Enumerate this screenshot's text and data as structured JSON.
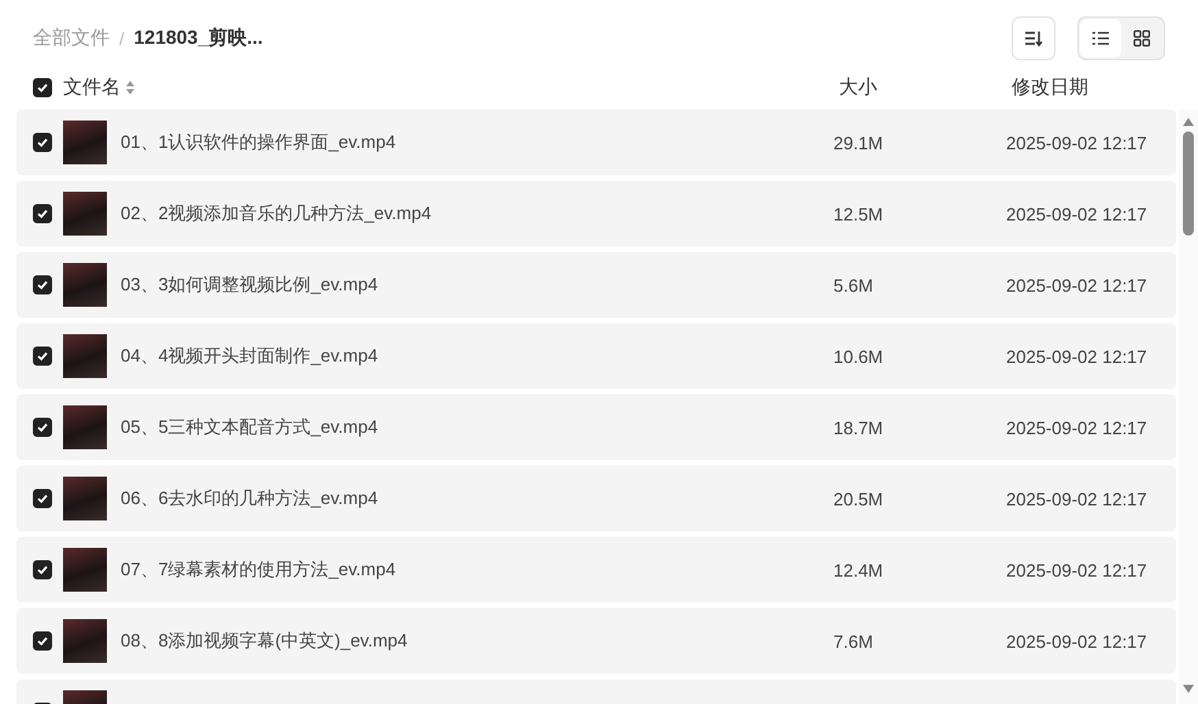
{
  "breadcrumb_separator": "/",
  "breadcrumb": [
    {
      "label": "全部文件",
      "current": false
    },
    {
      "label": "121803_剪映...",
      "current": true
    }
  ],
  "view_modes": [
    {
      "kind": "list",
      "selected": true
    },
    {
      "kind": "grid",
      "selected": false
    }
  ],
  "table": {
    "select_all": {
      "checked": true
    },
    "columns": [
      "文件名",
      "大小",
      "修改日期"
    ],
    "rows": [
      {
        "checked": true,
        "name": "01、1认识软件的操作界面_ev.mp4",
        "size": "29.1M",
        "modified": "2025-09-02 12:17"
      },
      {
        "checked": true,
        "name": "02、2视频添加音乐的几种方法_ev.mp4",
        "size": "12.5M",
        "modified": "2025-09-02 12:17"
      },
      {
        "checked": true,
        "name": "03、3如何调整视频比例_ev.mp4",
        "size": "5.6M",
        "modified": "2025-09-02 12:17"
      },
      {
        "checked": true,
        "name": "04、4视频开头封面制作_ev.mp4",
        "size": "10.6M",
        "modified": "2025-09-02 12:17"
      },
      {
        "checked": true,
        "name": "05、5三种文本配音方式_ev.mp4",
        "size": "18.7M",
        "modified": "2025-09-02 12:17"
      },
      {
        "checked": true,
        "name": "06、6去水印的几种方法_ev.mp4",
        "size": "20.5M",
        "modified": "2025-09-02 12:17"
      },
      {
        "checked": true,
        "name": "07、7绿幕素材的使用方法_ev.mp4",
        "size": "12.4M",
        "modified": "2025-09-02 12:17"
      },
      {
        "checked": true,
        "name": "08、8添加视频字幕(中英文)_ev.mp4",
        "size": "7.6M",
        "modified": "2025-09-02 12:17"
      },
      {
        "checked": true
      }
    ]
  }
}
